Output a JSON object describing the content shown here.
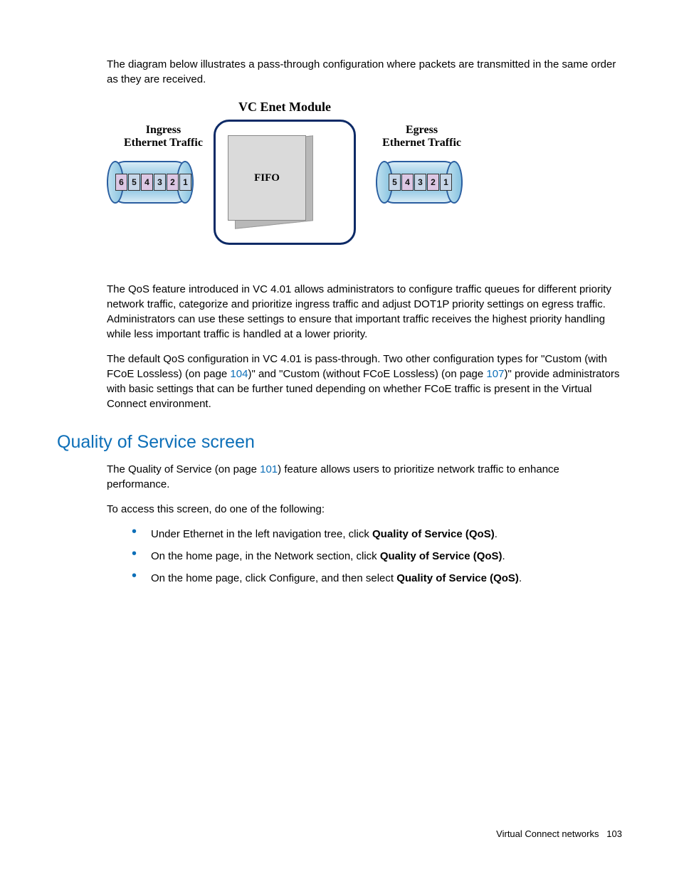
{
  "para1": "The diagram below illustrates a pass-through configuration where packets are transmitted in the same order as they are received.",
  "diagram": {
    "title": "VC Enet Module",
    "left_label_1": "Ingress",
    "left_label_2": "Ethernet Traffic",
    "right_label_1": "Egress",
    "right_label_2": "Ethernet Traffic",
    "fifo": "FIFO",
    "left_packets": [
      "6",
      "5",
      "4",
      "3",
      "2",
      "1"
    ],
    "right_packets": [
      "5",
      "4",
      "3",
      "2",
      "1"
    ]
  },
  "para2": "The QoS feature introduced in VC 4.01 allows administrators to configure traffic queues for different priority network traffic, categorize and prioritize ingress traffic and adjust DOT1P priority settings on egress traffic. Administrators can use these settings to ensure that important traffic receives the highest priority handling while less important traffic is handled at a lower priority.",
  "para3_pre": "The default QoS configuration in VC 4.01 is pass-through. Two other configuration types for \"Custom (with FCoE Lossless) (on page ",
  "para3_link1": "104",
  "para3_mid": ")\" and \"Custom (without FCoE Lossless) (on page ",
  "para3_link2": "107",
  "para3_post": ")\" provide administrators with basic settings that can be further tuned depending on whether FCoE traffic is present in the Virtual Connect environment.",
  "heading": "Quality of Service screen",
  "para4_pre": "The Quality of Service (on page ",
  "para4_link": "101",
  "para4_post": ") feature allows users to prioritize network traffic to enhance performance.",
  "para5": "To access this screen, do one of the following:",
  "bullets": [
    {
      "pre": "Under Ethernet in the left navigation tree, click ",
      "bold": "Quality of Service (QoS)",
      "post": "."
    },
    {
      "pre": "On the home page, in the Network section, click ",
      "bold": "Quality of Service (QoS)",
      "post": "."
    },
    {
      "pre": "On the home page, click Configure, and then select ",
      "bold": "Quality of Service (QoS)",
      "post": "."
    }
  ],
  "footer_text": "Virtual Connect networks",
  "footer_page": "103"
}
